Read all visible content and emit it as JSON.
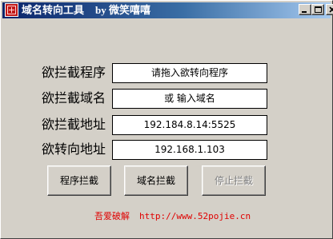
{
  "window": {
    "title": "域名转向工具",
    "author": "by 微笑嘻嘻",
    "icon": "app-icon"
  },
  "controls": {
    "minimize": "minimize-icon",
    "maximize": "maximize-icon",
    "close": "close-icon"
  },
  "form": {
    "rows": [
      {
        "label": "欲拦截程序",
        "value": "请拖入欲转向程序"
      },
      {
        "label": "欲拦截域名",
        "value": "或 输入域名"
      },
      {
        "label": "欲拦截地址",
        "value": "192.184.8.14:5525"
      },
      {
        "label": "欲转向地址",
        "value": "192.168.1.103"
      }
    ]
  },
  "buttons": {
    "intercept_program": "程序拦截",
    "intercept_domain": "域名拦截",
    "stop_intercept": "停止拦截"
  },
  "footer": {
    "site_name": "吾爱破解",
    "url": "http://www.52pojie.cn"
  },
  "colors": {
    "title_start": "#0a246a",
    "title_end": "#a6caf0",
    "footer_text": "#e00000"
  }
}
